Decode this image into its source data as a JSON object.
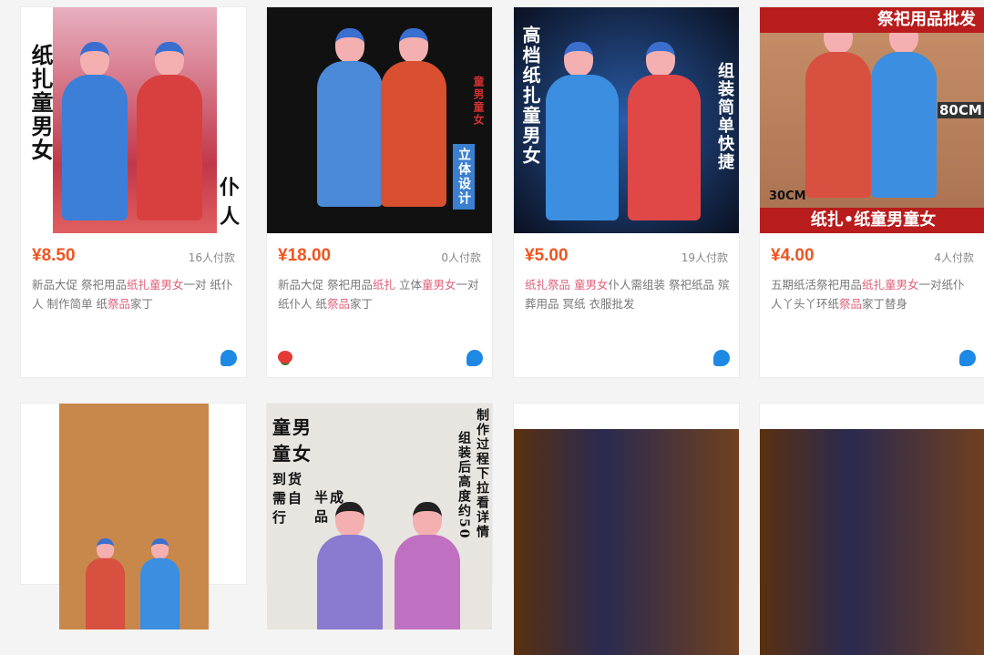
{
  "products": [
    {
      "price": "¥8.50",
      "sold": "16人付款",
      "desc": [
        {
          "t": "新品大促 祭祀用品",
          "hl": false
        },
        {
          "t": "纸扎童男女",
          "hl": true
        },
        {
          "t": "一对 纸仆人 制作简单 纸",
          "hl": false
        },
        {
          "t": "祭品",
          "hl": true
        },
        {
          "t": "家丁",
          "hl": false
        }
      ],
      "img_text": [
        "纸扎童男女",
        "仆人"
      ],
      "icon": "wangwang-icon"
    },
    {
      "price": "¥18.00",
      "sold": "0人付款",
      "desc": [
        {
          "t": "新品大促 祭祀用品",
          "hl": false
        },
        {
          "t": "纸扎",
          "hl": true
        },
        {
          "t": " 立体",
          "hl": false
        },
        {
          "t": "童男女",
          "hl": true
        },
        {
          "t": "一对 纸仆人 纸",
          "hl": false
        },
        {
          "t": "祭品",
          "hl": true
        },
        {
          "t": "家丁",
          "hl": false
        }
      ],
      "img_text": [
        "童男童女",
        "立体设计"
      ],
      "icon": "wangwang-icon"
    },
    {
      "price": "¥5.00",
      "sold": "19人付款",
      "desc": [
        {
          "t": "纸扎祭品",
          "hl": true
        },
        {
          "t": " ",
          "hl": false
        },
        {
          "t": "童男女",
          "hl": true
        },
        {
          "t": "仆人需组装 祭祀纸品 殡葬用品 冥纸 衣服批发",
          "hl": false
        }
      ],
      "img_text": [
        "高档纸扎童男女",
        "组装简单快捷"
      ],
      "icon": "wangwang-icon"
    },
    {
      "price": "¥4.00",
      "sold": "4人付款",
      "desc": [
        {
          "t": "五期纸活祭祀用品",
          "hl": false
        },
        {
          "t": "纸扎童男女",
          "hl": true
        },
        {
          "t": "一对纸仆人丫头丫环纸",
          "hl": false
        },
        {
          "t": "祭品",
          "hl": true
        },
        {
          "t": "家丁替身",
          "hl": false
        }
      ],
      "img_text": [
        "祭祀用品批发",
        "80CM",
        "30CM",
        "纸扎•纸童男童女"
      ],
      "icon": "wangwang-icon"
    }
  ],
  "row2_img_text": [
    "童男童女",
    "到货需自行",
    "半成品",
    "制作过程下拉看详情",
    "组装后高度约50"
  ]
}
